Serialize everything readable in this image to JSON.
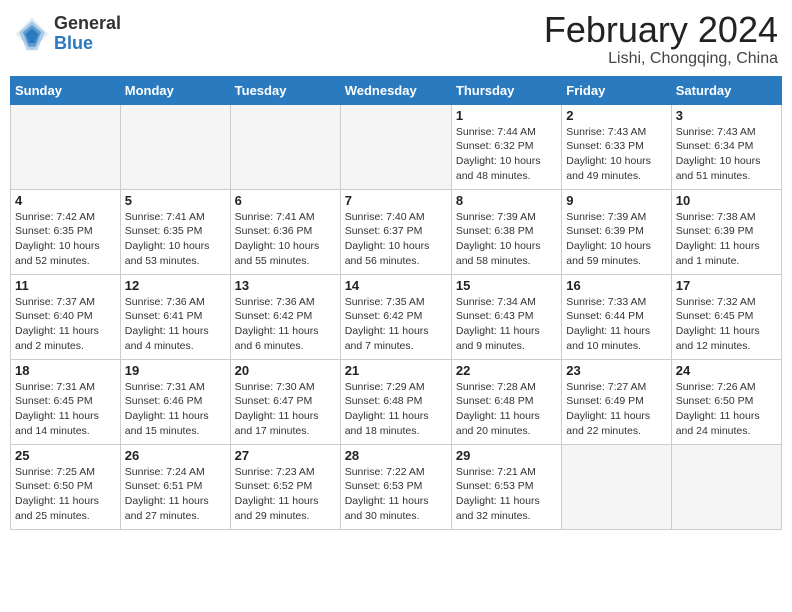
{
  "logo": {
    "general": "General",
    "blue": "Blue"
  },
  "title": {
    "month_year": "February 2024",
    "location": "Lishi, Chongqing, China"
  },
  "weekdays": [
    "Sunday",
    "Monday",
    "Tuesday",
    "Wednesday",
    "Thursday",
    "Friday",
    "Saturday"
  ],
  "weeks": [
    [
      {
        "day": "",
        "sunrise": "",
        "sunset": "",
        "daylight": "",
        "empty": true
      },
      {
        "day": "",
        "sunrise": "",
        "sunset": "",
        "daylight": "",
        "empty": true
      },
      {
        "day": "",
        "sunrise": "",
        "sunset": "",
        "daylight": "",
        "empty": true
      },
      {
        "day": "",
        "sunrise": "",
        "sunset": "",
        "daylight": "",
        "empty": true
      },
      {
        "day": "1",
        "sunrise": "Sunrise: 7:44 AM",
        "sunset": "Sunset: 6:32 PM",
        "daylight": "Daylight: 10 hours and 48 minutes.",
        "empty": false
      },
      {
        "day": "2",
        "sunrise": "Sunrise: 7:43 AM",
        "sunset": "Sunset: 6:33 PM",
        "daylight": "Daylight: 10 hours and 49 minutes.",
        "empty": false
      },
      {
        "day": "3",
        "sunrise": "Sunrise: 7:43 AM",
        "sunset": "Sunset: 6:34 PM",
        "daylight": "Daylight: 10 hours and 51 minutes.",
        "empty": false
      }
    ],
    [
      {
        "day": "4",
        "sunrise": "Sunrise: 7:42 AM",
        "sunset": "Sunset: 6:35 PM",
        "daylight": "Daylight: 10 hours and 52 minutes.",
        "empty": false
      },
      {
        "day": "5",
        "sunrise": "Sunrise: 7:41 AM",
        "sunset": "Sunset: 6:35 PM",
        "daylight": "Daylight: 10 hours and 53 minutes.",
        "empty": false
      },
      {
        "day": "6",
        "sunrise": "Sunrise: 7:41 AM",
        "sunset": "Sunset: 6:36 PM",
        "daylight": "Daylight: 10 hours and 55 minutes.",
        "empty": false
      },
      {
        "day": "7",
        "sunrise": "Sunrise: 7:40 AM",
        "sunset": "Sunset: 6:37 PM",
        "daylight": "Daylight: 10 hours and 56 minutes.",
        "empty": false
      },
      {
        "day": "8",
        "sunrise": "Sunrise: 7:39 AM",
        "sunset": "Sunset: 6:38 PM",
        "daylight": "Daylight: 10 hours and 58 minutes.",
        "empty": false
      },
      {
        "day": "9",
        "sunrise": "Sunrise: 7:39 AM",
        "sunset": "Sunset: 6:39 PM",
        "daylight": "Daylight: 10 hours and 59 minutes.",
        "empty": false
      },
      {
        "day": "10",
        "sunrise": "Sunrise: 7:38 AM",
        "sunset": "Sunset: 6:39 PM",
        "daylight": "Daylight: 11 hours and 1 minute.",
        "empty": false
      }
    ],
    [
      {
        "day": "11",
        "sunrise": "Sunrise: 7:37 AM",
        "sunset": "Sunset: 6:40 PM",
        "daylight": "Daylight: 11 hours and 2 minutes.",
        "empty": false
      },
      {
        "day": "12",
        "sunrise": "Sunrise: 7:36 AM",
        "sunset": "Sunset: 6:41 PM",
        "daylight": "Daylight: 11 hours and 4 minutes.",
        "empty": false
      },
      {
        "day": "13",
        "sunrise": "Sunrise: 7:36 AM",
        "sunset": "Sunset: 6:42 PM",
        "daylight": "Daylight: 11 hours and 6 minutes.",
        "empty": false
      },
      {
        "day": "14",
        "sunrise": "Sunrise: 7:35 AM",
        "sunset": "Sunset: 6:42 PM",
        "daylight": "Daylight: 11 hours and 7 minutes.",
        "empty": false
      },
      {
        "day": "15",
        "sunrise": "Sunrise: 7:34 AM",
        "sunset": "Sunset: 6:43 PM",
        "daylight": "Daylight: 11 hours and 9 minutes.",
        "empty": false
      },
      {
        "day": "16",
        "sunrise": "Sunrise: 7:33 AM",
        "sunset": "Sunset: 6:44 PM",
        "daylight": "Daylight: 11 hours and 10 minutes.",
        "empty": false
      },
      {
        "day": "17",
        "sunrise": "Sunrise: 7:32 AM",
        "sunset": "Sunset: 6:45 PM",
        "daylight": "Daylight: 11 hours and 12 minutes.",
        "empty": false
      }
    ],
    [
      {
        "day": "18",
        "sunrise": "Sunrise: 7:31 AM",
        "sunset": "Sunset: 6:45 PM",
        "daylight": "Daylight: 11 hours and 14 minutes.",
        "empty": false
      },
      {
        "day": "19",
        "sunrise": "Sunrise: 7:31 AM",
        "sunset": "Sunset: 6:46 PM",
        "daylight": "Daylight: 11 hours and 15 minutes.",
        "empty": false
      },
      {
        "day": "20",
        "sunrise": "Sunrise: 7:30 AM",
        "sunset": "Sunset: 6:47 PM",
        "daylight": "Daylight: 11 hours and 17 minutes.",
        "empty": false
      },
      {
        "day": "21",
        "sunrise": "Sunrise: 7:29 AM",
        "sunset": "Sunset: 6:48 PM",
        "daylight": "Daylight: 11 hours and 18 minutes.",
        "empty": false
      },
      {
        "day": "22",
        "sunrise": "Sunrise: 7:28 AM",
        "sunset": "Sunset: 6:48 PM",
        "daylight": "Daylight: 11 hours and 20 minutes.",
        "empty": false
      },
      {
        "day": "23",
        "sunrise": "Sunrise: 7:27 AM",
        "sunset": "Sunset: 6:49 PM",
        "daylight": "Daylight: 11 hours and 22 minutes.",
        "empty": false
      },
      {
        "day": "24",
        "sunrise": "Sunrise: 7:26 AM",
        "sunset": "Sunset: 6:50 PM",
        "daylight": "Daylight: 11 hours and 24 minutes.",
        "empty": false
      }
    ],
    [
      {
        "day": "25",
        "sunrise": "Sunrise: 7:25 AM",
        "sunset": "Sunset: 6:50 PM",
        "daylight": "Daylight: 11 hours and 25 minutes.",
        "empty": false
      },
      {
        "day": "26",
        "sunrise": "Sunrise: 7:24 AM",
        "sunset": "Sunset: 6:51 PM",
        "daylight": "Daylight: 11 hours and 27 minutes.",
        "empty": false
      },
      {
        "day": "27",
        "sunrise": "Sunrise: 7:23 AM",
        "sunset": "Sunset: 6:52 PM",
        "daylight": "Daylight: 11 hours and 29 minutes.",
        "empty": false
      },
      {
        "day": "28",
        "sunrise": "Sunrise: 7:22 AM",
        "sunset": "Sunset: 6:53 PM",
        "daylight": "Daylight: 11 hours and 30 minutes.",
        "empty": false
      },
      {
        "day": "29",
        "sunrise": "Sunrise: 7:21 AM",
        "sunset": "Sunset: 6:53 PM",
        "daylight": "Daylight: 11 hours and 32 minutes.",
        "empty": false
      },
      {
        "day": "",
        "sunrise": "",
        "sunset": "",
        "daylight": "",
        "empty": true
      },
      {
        "day": "",
        "sunrise": "",
        "sunset": "",
        "daylight": "",
        "empty": true
      }
    ]
  ]
}
